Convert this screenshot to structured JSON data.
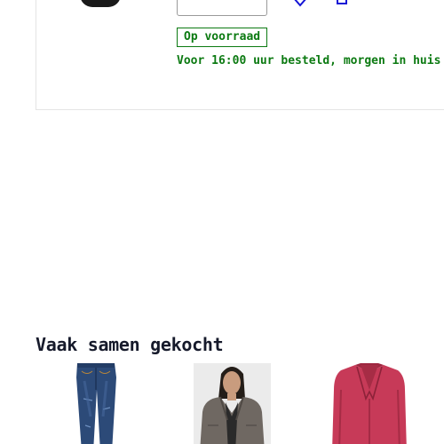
{
  "product": {
    "stock_status": "Op voorraad",
    "delivery_note": "Voor 16:00 uur besteld, morgen in huis",
    "status_color": "#0c7a12",
    "icons": [
      "wishlist-heart-icon",
      "shopping-bag-icon"
    ]
  },
  "related": {
    "title": "Vaak samen gekocht",
    "items": [
      {
        "image": "blue-skinny-jeans"
      },
      {
        "image": "model-in-grey-jacket"
      },
      {
        "image": "pink-blazer"
      }
    ]
  }
}
